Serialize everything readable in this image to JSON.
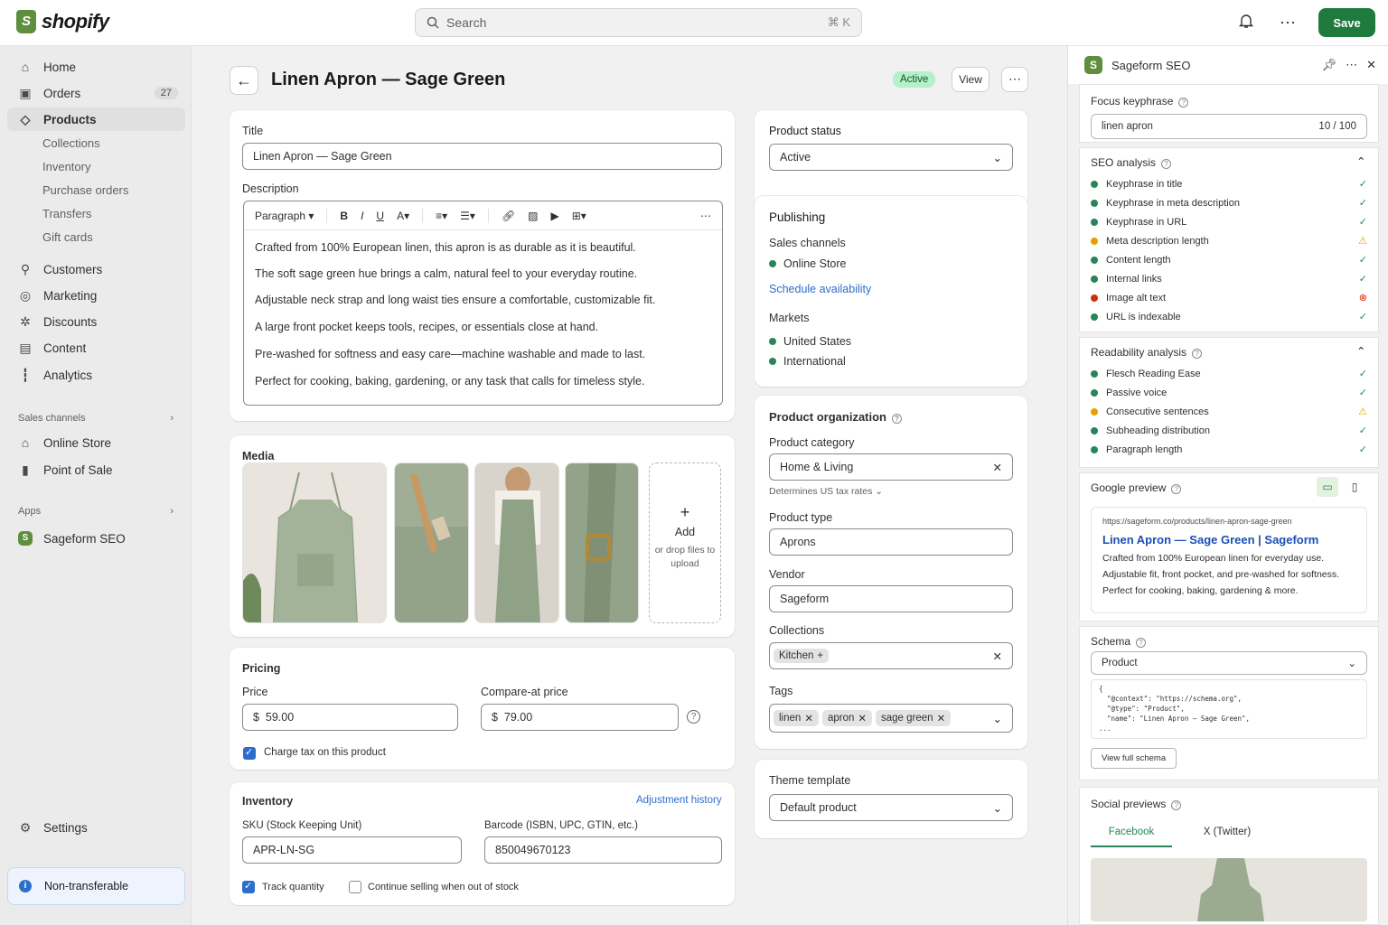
{
  "topbar": {
    "logo_text": "shopify",
    "search_placeholder": "Search",
    "search_shortcut": "⌘ K",
    "save_label": "Save"
  },
  "sidebar": {
    "items": [
      {
        "label": "Home"
      },
      {
        "label": "Orders",
        "count": "27"
      },
      {
        "label": "Products"
      },
      {
        "label": "Customers"
      },
      {
        "label": "Marketing"
      },
      {
        "label": "Discounts"
      },
      {
        "label": "Content"
      },
      {
        "label": "Analytics"
      }
    ],
    "product_sub": [
      "Collections",
      "Inventory",
      "Purchase orders",
      "Transfers",
      "Gift cards"
    ],
    "sales_channels_label": "Sales channels",
    "channels": [
      "Online Store",
      "Point of Sale"
    ],
    "apps_label": "Apps",
    "apps": [
      "Sageform SEO"
    ],
    "settings_label": "Settings",
    "notice": "Non-transferable"
  },
  "product": {
    "title": "Linen Apron — Sage Green",
    "status_badge": "Active",
    "view_label": "View",
    "title_label": "Title",
    "title_value": "Linen Apron — Sage Green",
    "description_label": "Description",
    "paragraph_label": "Paragraph",
    "description": [
      "Crafted from 100% European linen, this apron is as durable as it is beautiful.",
      "The soft sage green hue brings a calm, natural feel to your everyday routine.",
      "Adjustable neck strap and long waist ties ensure a comfortable, customizable fit.",
      "A large front pocket keeps tools, recipes, or essentials close at hand.",
      "Pre-washed for softness and easy care—machine washable and made to last.",
      "Perfect for cooking, baking, gardening, or any task that calls for timeless style."
    ],
    "media_label": "Media",
    "media_add": "Add",
    "media_drop": "or drop files to upload",
    "pricing_label": "Pricing",
    "price_label": "Price",
    "price_currency": "$",
    "price_value": "59.00",
    "compare_label": "Compare-at price",
    "compare_value": "79.00",
    "charge_tax": "Charge tax on this product",
    "inventory_label": "Inventory",
    "adjustment_history": "Adjustment history",
    "sku_label": "SKU (Stock Keeping Unit)",
    "sku_value": "APR-LN-SG",
    "barcode_label": "Barcode (ISBN, UPC, GTIN, etc.)",
    "barcode_value": "850049670123",
    "track_quantity": "Track quantity",
    "continue_selling": "Continue selling when out of stock"
  },
  "right": {
    "status_label": "Product status",
    "status_value": "Active",
    "publishing_label": "Publishing",
    "sales_channels_label": "Sales channels",
    "sales_channel": "Online Store",
    "schedule": "Schedule availability",
    "markets_label": "Markets",
    "markets": [
      "United States",
      "International"
    ],
    "org_label": "Product organization",
    "category_label": "Product category",
    "category_value": "Home & Living",
    "tax_note": "Determines US tax rates",
    "type_label": "Product type",
    "type_value": "Aprons",
    "vendor_label": "Vendor",
    "vendor_value": "Sageform",
    "collections_label": "Collections",
    "collection_tag": "Kitchen",
    "tags_label": "Tags",
    "tags": [
      "linen",
      "apron",
      "sage green"
    ],
    "theme_label": "Theme template",
    "theme_value": "Default product"
  },
  "seo": {
    "app_name": "Sageform SEO",
    "focus_label": "Focus keyphrase",
    "focus_value": "linen apron",
    "focus_count": "10 / 100",
    "analysis_label": "SEO analysis",
    "checks": [
      {
        "label": "Keyphrase in title",
        "status": "good"
      },
      {
        "label": "Keyphrase in meta description",
        "status": "good"
      },
      {
        "label": "Keyphrase in URL",
        "status": "good"
      },
      {
        "label": "Meta description length",
        "status": "warning"
      },
      {
        "label": "Content length",
        "status": "good"
      },
      {
        "label": "Internal links",
        "status": "good"
      },
      {
        "label": "Image alt text",
        "status": "error"
      },
      {
        "label": "URL is indexable",
        "status": "good"
      }
    ],
    "readability_label": "Readability analysis",
    "readability": [
      {
        "label": "Flesch Reading Ease",
        "status": "good"
      },
      {
        "label": "Passive voice",
        "status": "good"
      },
      {
        "label": "Consecutive sentences",
        "status": "warning"
      },
      {
        "label": "Subheading distribution",
        "status": "good"
      },
      {
        "label": "Paragraph length",
        "status": "good"
      }
    ],
    "google_label": "Google preview",
    "preview_url": "https://sageform.co/products/linen-apron-sage-green",
    "preview_title": "Linen Apron — Sage Green | Sageform",
    "preview_desc": "Crafted from 100% European linen for everyday use. Adjustable fit, front pocket, and pre-washed for softness. Perfect for cooking, baking, gardening & more.",
    "schema_label": "Schema",
    "schema_value": "Product",
    "schema_code": "{\n  \"@context\": \"https://schema.org\",\n  \"@type\": \"Product\",\n  \"name\": \"Linen Apron – Sage Green\",\n...",
    "view_schema": "View full schema",
    "social_label": "Social previews",
    "tab_facebook": "Facebook",
    "tab_twitter": "X (Twitter)"
  },
  "colors": {
    "accent": "#1f7a3d",
    "brand": "#5e8e3e",
    "good": "#29845a",
    "warning": "#e5a100",
    "error": "#d72c0d",
    "link": "#2c6ecb"
  }
}
